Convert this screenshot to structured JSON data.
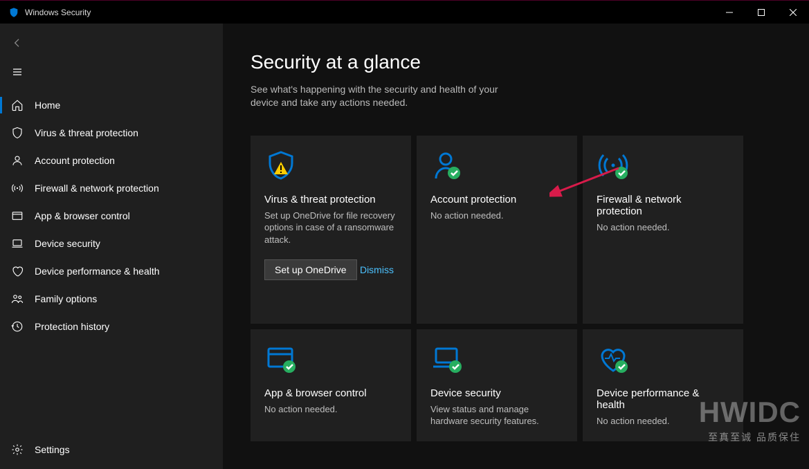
{
  "window": {
    "title": "Windows Security"
  },
  "sidebar": {
    "items": [
      {
        "label": "Home",
        "icon": "home-icon",
        "active": true
      },
      {
        "label": "Virus & threat protection",
        "icon": "shield-icon"
      },
      {
        "label": "Account protection",
        "icon": "person-icon"
      },
      {
        "label": "Firewall & network protection",
        "icon": "antenna-icon"
      },
      {
        "label": "App & browser control",
        "icon": "browser-icon"
      },
      {
        "label": "Device security",
        "icon": "laptop-icon"
      },
      {
        "label": "Device performance & health",
        "icon": "heart-icon"
      },
      {
        "label": "Family options",
        "icon": "family-icon"
      },
      {
        "label": "Protection history",
        "icon": "history-icon"
      }
    ],
    "settings_label": "Settings"
  },
  "page": {
    "title": "Security at a glance",
    "subtitle": "See what's happening with the security and health of your device and take any actions needed."
  },
  "cards": [
    {
      "icon": "shield-warning",
      "title": "Virus & threat protection",
      "desc": "Set up OneDrive for file recovery options in case of a ransomware attack.",
      "button": "Set up OneDrive",
      "link": "Dismiss"
    },
    {
      "icon": "person-ok",
      "title": "Account protection",
      "desc": "No action needed."
    },
    {
      "icon": "antenna-ok",
      "title": "Firewall & network protection",
      "desc": "No action needed."
    },
    {
      "icon": "browser-ok",
      "title": "App & browser control",
      "desc": "No action needed."
    },
    {
      "icon": "laptop-ok",
      "title": "Device security",
      "desc": "View status and manage hardware security features."
    },
    {
      "icon": "heart-ok",
      "title": "Device performance & health",
      "desc": "No action needed."
    }
  ],
  "watermark": {
    "big": "HWIDC",
    "small": "至真至诚  品质保住"
  },
  "colors": {
    "accent": "#0078d4",
    "link": "#4cc2ff",
    "iconBlue": "#0078d4"
  }
}
